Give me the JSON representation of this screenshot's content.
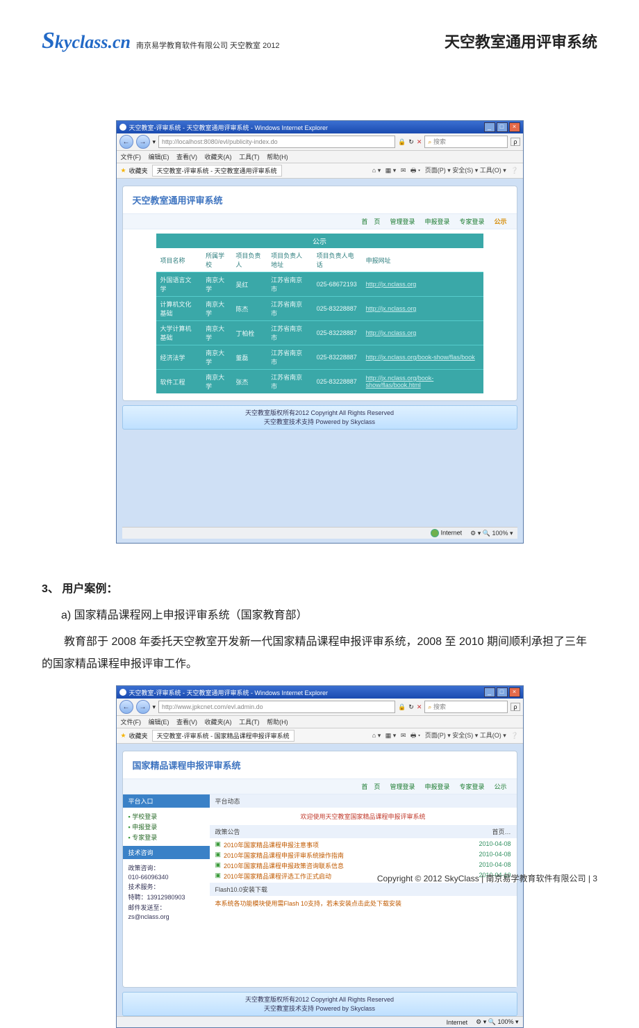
{
  "header": {
    "logo": "Skyclass.cn",
    "logo_sub": "南京易学教育软件有限公司  天空教室 2012",
    "right": "天空教室通用评审系统"
  },
  "shot1": {
    "title": "天空教室-评审系统 - 天空教室通用评审系统 - Windows Internet Explorer",
    "url": "http://localhost:8080/evl/publicity-index.do",
    "search_placeholder": "搜索",
    "menus": [
      "文件(F)",
      "编辑(E)",
      "查看(V)",
      "收藏夹(A)",
      "工具(T)",
      "帮助(H)"
    ],
    "fav_label": "收藏夹",
    "fav_tab": "天空教室-评审系统 - 天空教室通用评审系统",
    "right_tools": "页面(P) ▾  安全(S) ▾  工具(O) ▾",
    "panel_title": "天空教室通用评审系统",
    "tabs": [
      "首　页",
      "管理登录",
      "申报登录",
      "专家登录",
      "公示"
    ],
    "tab_active_index": 4,
    "sub_header": "公示",
    "columns": [
      "项目名称",
      "所属学校",
      "项目负责人",
      "项目负责人地址",
      "项目负责人电话",
      "申报网址"
    ],
    "rows": [
      {
        "c0": "外国语言文学",
        "c1": "南京大学",
        "c2": "吴红",
        "c3": "江苏省南京市",
        "c4": "025-68672193",
        "c5": "http://jx.nclass.org"
      },
      {
        "c0": "计算机文化基础",
        "c1": "南京大学",
        "c2": "陈杰",
        "c3": "江苏省南京市",
        "c4": "025-83228887",
        "c5": "http://jx.nclass.org"
      },
      {
        "c0": "大学计算机基础",
        "c1": "南京大学",
        "c2": "丁柏栓",
        "c3": "江苏省南京市",
        "c4": "025-83228887",
        "c5": "http://jx.nclass.org"
      },
      {
        "c0": "经济法学",
        "c1": "南京大学",
        "c2": "董磊",
        "c3": "江苏省南京市",
        "c4": "025-83228887",
        "c5": "http://jx.nclass.org/book-show/flas/book"
      },
      {
        "c0": "软件工程",
        "c1": "南京大学",
        "c2": "张杰",
        "c3": "江苏省南京市",
        "c4": "025-83228887",
        "c5": "http://jx.nclass.org/book-show/flas/book.html"
      }
    ],
    "footer1": "天空教室版权所有2012 Copyright All Rights Reserved",
    "footer2": "天空教室技术支持 Powered by Skyclass",
    "status_net": "Internet",
    "status_zoom": "100%"
  },
  "text": {
    "h3": "3、 用户案例：",
    "a": "a)   国家精品课程网上申报评审系统（国家教育部）",
    "p": "教育部于 2008 年委托天空教室开发新一代国家精品课程申报评审系统，2008 至 2010 期间顺利承担了三年的国家精品课程申报评审工作。"
  },
  "shot2": {
    "title": "天空教室-评审系统 - 天空教室通用评审系统 - Windows Internet Explorer",
    "url": "http://www.jpkcnet.com/evl.admin.do",
    "search_placeholder": "搜索",
    "menus": [
      "文件(F)",
      "编辑(E)",
      "查看(V)",
      "收藏夹(A)",
      "工具(T)",
      "帮助(H)"
    ],
    "fav_label": "收藏夹",
    "fav_tab": "天空教室-评审系统 - 国家精品课程申报评审系统",
    "right_tools": "页面(P) ▾  安全(S) ▾  工具(O) ▾",
    "panel_title": "国家精品课程申报评审系统",
    "tabs": [
      "首　页",
      "管理登录",
      "申报登录",
      "专家登录",
      "公示"
    ],
    "side": {
      "s1_h": "平台入口",
      "s1_items": [
        "学校登录",
        "申报登录",
        "专家登录"
      ],
      "s2_h": "技术咨询",
      "s2_lines": [
        "政策咨询：",
        "010-66096340",
        "技术服务：",
        "特聘：13912980903",
        "邮件发送至：",
        "zs@nclass.org"
      ]
    },
    "main": {
      "h1": "平台动态",
      "welcome": "欢迎使用天空教室国家精品课程申报评审系统",
      "h2": "政策公告",
      "h2_more": "首页…",
      "news": [
        {
          "t": "2010年国家精品课程申报注意事项",
          "d": "2010-04-08"
        },
        {
          "t": "2010年国家精品课程申报评审系统操作指南",
          "d": "2010-04-08"
        },
        {
          "t": "2010年国家精品课程申报政策咨询联系信息",
          "d": "2010-04-08"
        },
        {
          "t": "2010年国家精品课程评选工作正式启动",
          "d": "2010-04-10"
        }
      ],
      "h3": "Flash10.0安装下载",
      "flash": "本系统各功能模块使用需Flash 10支持，若未安装点击此处下载安装"
    },
    "footer1": "天空教室版权所有2012 Copyright All Rights Reserved",
    "footer2": "天空教室技术支持 Powered by Skyclass",
    "status_net": "Internet",
    "status_zoom": "100%"
  },
  "page_footer": "Copyright  ©  2012  SkyClass   | 南京易学教育软件有限公司 | 3"
}
